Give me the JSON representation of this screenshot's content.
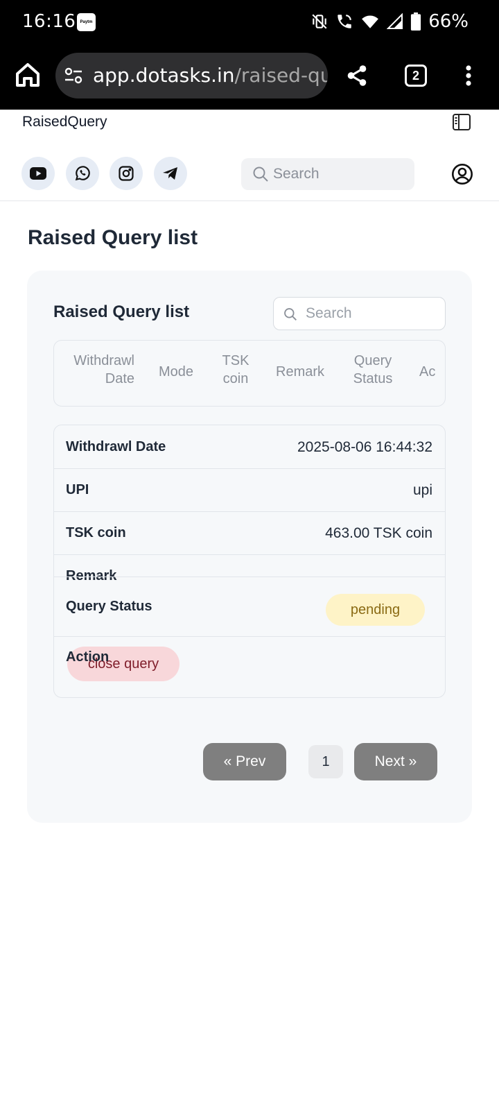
{
  "status_bar": {
    "time": "16:16",
    "paytm_label": "Paytm",
    "battery": "66%",
    "icons": [
      "mute-vibrate-icon",
      "wifi-call-icon",
      "wifi-icon",
      "signal-icon",
      "battery-icon"
    ]
  },
  "browser": {
    "url_host": "app.dotasks.in",
    "url_path": "/raised-qu",
    "tab_count": "2"
  },
  "site": {
    "title": "RaisedQuery",
    "social": [
      "youtube-icon",
      "whatsapp-icon",
      "instagram-icon",
      "telegram-icon"
    ],
    "search_placeholder": "Search"
  },
  "page": {
    "title": "Raised Query list"
  },
  "card": {
    "title": "Raised Query list",
    "search_placeholder": "Search",
    "columns": [
      {
        "line1": "Withdrawl",
        "line2": "Date"
      },
      {
        "line1": "Mode",
        "line2": ""
      },
      {
        "line1": "TSK",
        "line2": "coin"
      },
      {
        "line1": "Remark",
        "line2": ""
      },
      {
        "line1": "Query",
        "line2": "Status"
      },
      {
        "line1": "Ac",
        "line2": ""
      }
    ],
    "row": {
      "withdrawl_label": "Withdrawl Date",
      "withdrawl_value": "2025-08-06 16:44:32",
      "mode_label": "UPI",
      "mode_value": "upi",
      "coin_label": "TSK coin",
      "coin_value": "463.00 TSK coin",
      "remark_label": "Remark",
      "status_label": "Query Status",
      "status_value": "pending",
      "action_label": "Action",
      "action_button": "close query"
    },
    "pagination": {
      "prev": "« Prev",
      "page": "1",
      "next": "Next »"
    }
  },
  "colors": {
    "status_bar_bg": "#000000",
    "card_bg": "#f6f8fa",
    "pending_bg": "#fef3c7",
    "close_bg": "#f8d7da",
    "pager_bg": "#7f7f7f"
  }
}
